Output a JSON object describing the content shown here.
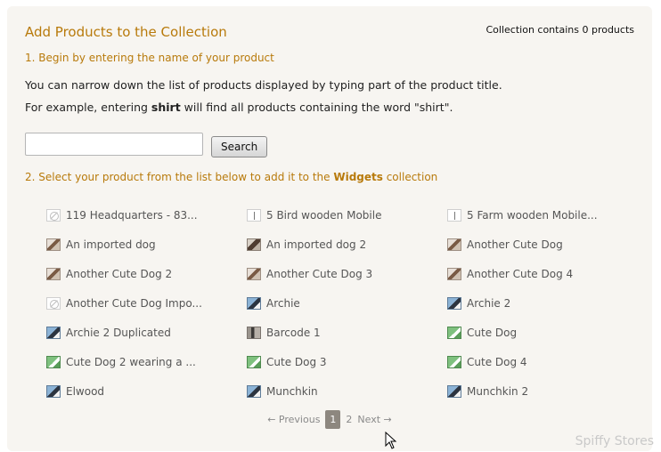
{
  "header": {
    "title": "Add Products to the Collection",
    "count": "Collection contains 0 products"
  },
  "steps": {
    "step1": "1.  Begin by entering the name of your product",
    "desc1": "You can narrow down the list of products displayed by typing part of the product title.",
    "desc2_prefix": "For example, entering ",
    "desc2_bold": "shirt",
    "desc2_suffix": " will find all products containing the word \"shirt\".",
    "step2_prefix": "2.  Select your product from the list below to add it to the ",
    "step2_bold": "Widgets",
    "step2_suffix": " collection"
  },
  "search": {
    "value": "",
    "placeholder": "",
    "button_label": "Search"
  },
  "products": [
    {
      "label": "119 Headquarters - 83...",
      "icon": "none"
    },
    {
      "label": "5 Bird wooden Mobile",
      "icon": "mobile"
    },
    {
      "label": "5 Farm wooden Mobile...",
      "icon": "mobile"
    },
    {
      "label": "An imported dog",
      "icon": "dog"
    },
    {
      "label": "An imported dog 2",
      "icon": "dog2"
    },
    {
      "label": "Another Cute Dog",
      "icon": "dog"
    },
    {
      "label": "Another Cute Dog 2",
      "icon": "dog"
    },
    {
      "label": "Another Cute Dog 3",
      "icon": "dog"
    },
    {
      "label": "Another Cute Dog 4",
      "icon": "dog"
    },
    {
      "label": "Another Cute Dog Impo...",
      "icon": "none"
    },
    {
      "label": "Archie",
      "icon": "archie"
    },
    {
      "label": "Archie 2",
      "icon": "archie"
    },
    {
      "label": "Archie 2 Duplicated",
      "icon": "archie"
    },
    {
      "label": "Barcode 1",
      "icon": "bar"
    },
    {
      "label": "Cute Dog",
      "icon": "cute"
    },
    {
      "label": "Cute Dog 2 wearing a ...",
      "icon": "cute"
    },
    {
      "label": "Cute Dog 3",
      "icon": "cute"
    },
    {
      "label": "Cute Dog 4",
      "icon": "cute"
    },
    {
      "label": "Elwood",
      "icon": "archie"
    },
    {
      "label": "Munchkin",
      "icon": "archie"
    },
    {
      "label": "Munchkin 2",
      "icon": "archie"
    }
  ],
  "pager": {
    "previous": "← Previous",
    "current": "1",
    "page2": "2",
    "next": "Next →"
  },
  "footer": {
    "brand": "Spiffy Stores"
  }
}
